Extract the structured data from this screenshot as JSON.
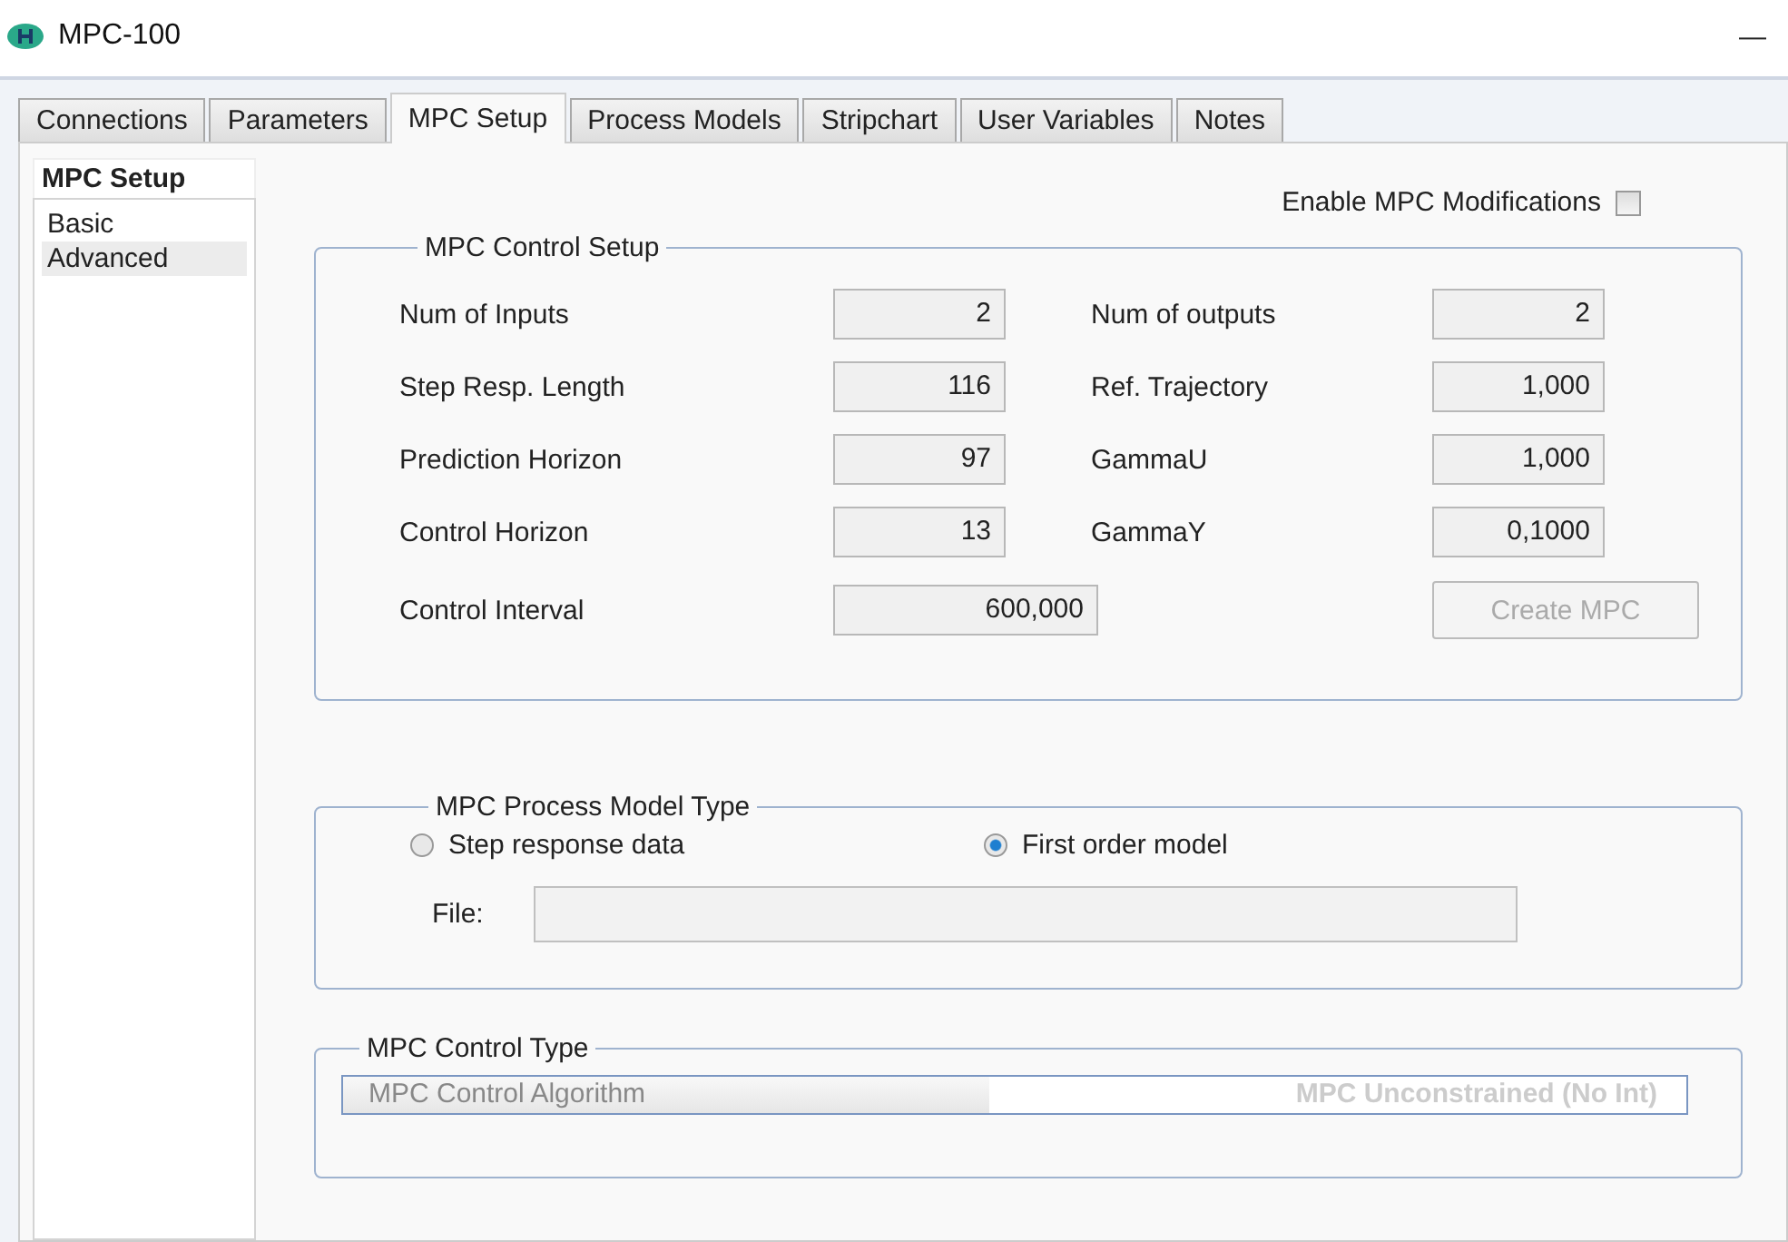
{
  "window": {
    "title": "MPC-100",
    "minimize": "—"
  },
  "tabs": [
    {
      "label": "Connections",
      "selected": false
    },
    {
      "label": "Parameters",
      "selected": false
    },
    {
      "label": "MPC Setup",
      "selected": true
    },
    {
      "label": "Process Models",
      "selected": false
    },
    {
      "label": "Stripchart",
      "selected": false
    },
    {
      "label": "User Variables",
      "selected": false
    },
    {
      "label": "Notes",
      "selected": false
    }
  ],
  "sidebar": {
    "header": "MPC Setup",
    "items": [
      {
        "label": "Basic",
        "selected": false
      },
      {
        "label": "Advanced",
        "selected": true
      }
    ]
  },
  "enable_modifications": {
    "label": "Enable MPC Modifications",
    "checked": false
  },
  "control_setup": {
    "title": "MPC Control Setup",
    "left_fields": [
      {
        "label": "Num of Inputs",
        "value": "2"
      },
      {
        "label": "Step Resp. Length",
        "value": "116"
      },
      {
        "label": "Prediction Horizon",
        "value": "97"
      },
      {
        "label": "Control Horizon",
        "value": "13"
      }
    ],
    "right_fields": [
      {
        "label": "Num of outputs",
        "value": "2"
      },
      {
        "label": "Ref. Trajectory",
        "value": "1,000"
      },
      {
        "label": "GammaU",
        "value": "1,000"
      },
      {
        "label": "GammaY",
        "value": "0,1000"
      }
    ],
    "interval": {
      "label": "Control Interval",
      "value": "600,000"
    },
    "create_button": {
      "label": "Create MPC",
      "disabled": true
    }
  },
  "process_model": {
    "title": "MPC Process Model Type",
    "options": [
      {
        "label": "Step response data",
        "selected": false
      },
      {
        "label": "First order model",
        "selected": true
      }
    ],
    "file": {
      "label": "File:"
    }
  },
  "control_type": {
    "title": "MPC Control Type",
    "label": "MPC Control Algorithm",
    "value": "MPC Unconstrained (No Int)",
    "disabled": true
  }
}
